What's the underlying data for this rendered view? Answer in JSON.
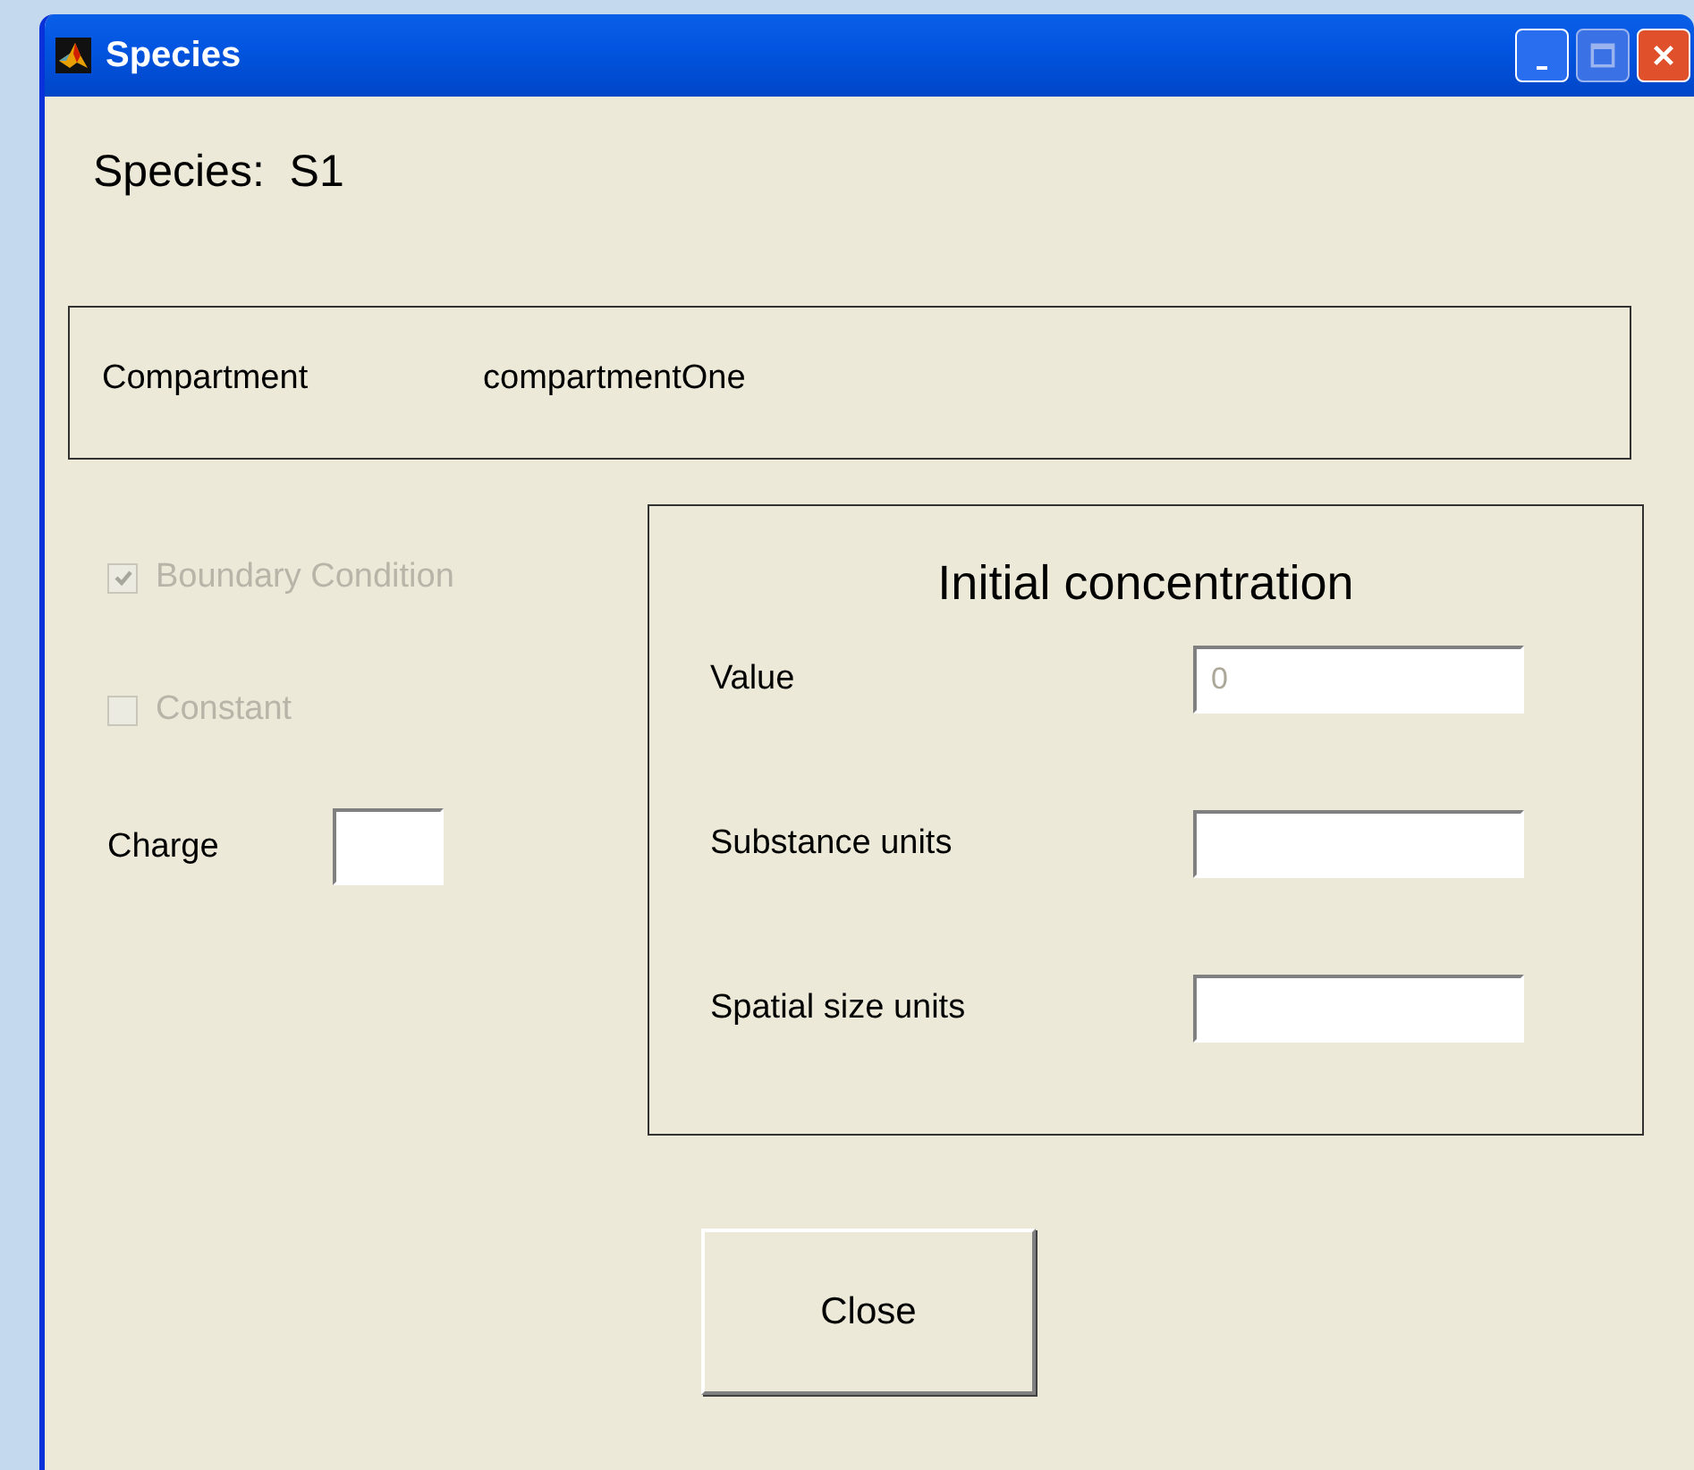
{
  "window": {
    "title": "Species"
  },
  "heading": "Species:  S1",
  "compartment": {
    "label": "Compartment",
    "value": "compartmentOne"
  },
  "checkboxes": [
    {
      "label": "Boundary Condition",
      "checked": true,
      "disabled": true
    },
    {
      "label": "Constant",
      "checked": false,
      "disabled": true
    }
  ],
  "charge": {
    "label": "Charge"
  },
  "initial_concentration": {
    "title": "Initial concentration",
    "fields": [
      {
        "label": "Value",
        "value": "0",
        "disabled": true
      },
      {
        "label": "Substance units"
      },
      {
        "label": "Spatial size units"
      }
    ]
  },
  "close_button": "Close"
}
